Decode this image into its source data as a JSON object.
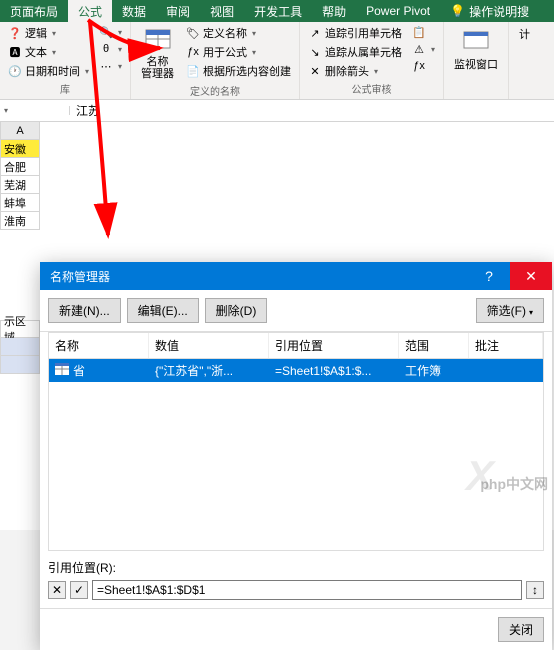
{
  "ribbon_tabs": {
    "layout": "页面布局",
    "formulas": "公式",
    "data": "数据",
    "review": "审阅",
    "view": "视图",
    "dev": "开发工具",
    "help": "帮助",
    "powerpivot": "Power Pivot",
    "tell_me": "操作说明搜"
  },
  "ribbon": {
    "logic": "逻辑",
    "text": "文本",
    "datetime": "日期和时间",
    "lib_label": "库",
    "name_manager": "名称\n管理器",
    "define_name": "定义名称",
    "use_in_formula": "用于公式",
    "create_from_sel": "根据所选内容创建",
    "defined_names_label": "定义的名称",
    "trace_precedents": "追踪引用单元格",
    "trace_dependents": "追踪从属单元格",
    "remove_arrows": "删除箭头",
    "formula_audit_label": "公式审核",
    "watch_window": "监视窗口",
    "calc": "计"
  },
  "name_box_suffix": "江苏",
  "sheet": {
    "colA": "A",
    "region_label": "示区域",
    "cells": [
      "安徽",
      "合肥",
      "芜湖",
      "蚌埠",
      "淮南"
    ]
  },
  "dialog": {
    "title": "名称管理器",
    "new": "新建(N)...",
    "edit": "编辑(E)...",
    "delete": "删除(D)",
    "filter": "筛选(F)",
    "col_name": "名称",
    "col_value": "数值",
    "col_ref": "引用位置",
    "col_scope": "范围",
    "col_note": "批注",
    "row": {
      "name": "省",
      "value": "{\"江苏省\",\"浙...",
      "ref": "=Sheet1!$A$1:$...",
      "scope": "工作簿",
      "note": ""
    },
    "ref_label": "引用位置(R):",
    "ref_value": "=Sheet1!$A$1:$D$1",
    "close": "关闭"
  },
  "watermark": "php中文网"
}
